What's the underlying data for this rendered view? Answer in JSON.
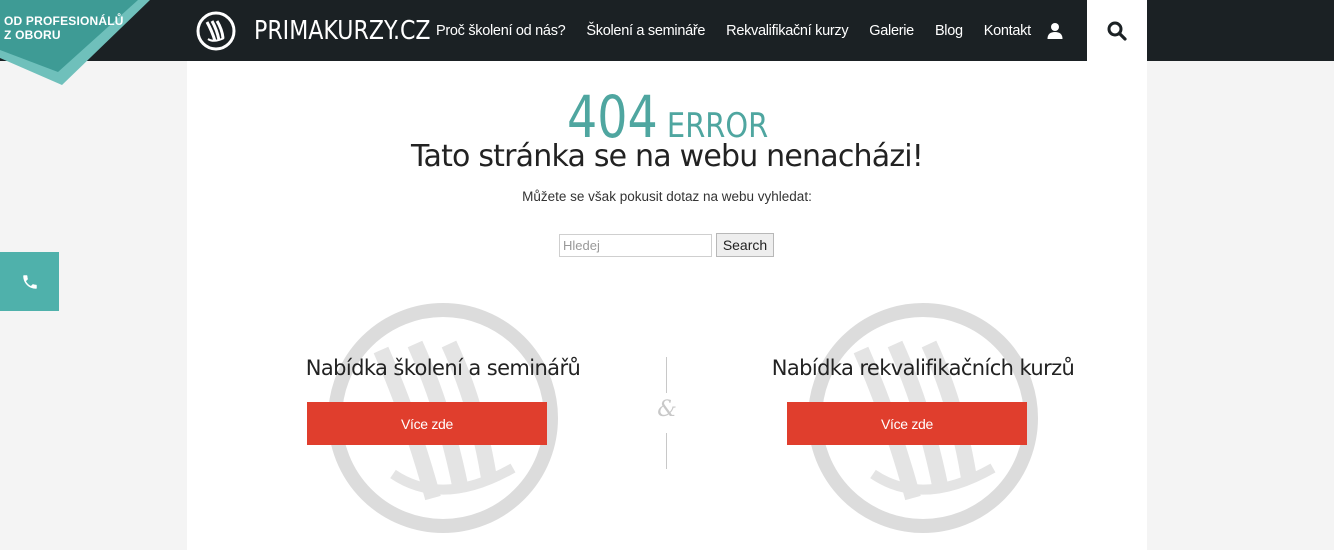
{
  "corner_badge": {
    "line1": "OD PROFESIONÁLŮ",
    "line2": "Z OBORU"
  },
  "brand": {
    "name": "PRIMAKURZY.CZ"
  },
  "menu": [
    {
      "label": "Proč školení od nás?"
    },
    {
      "label": "Školení a semináře"
    },
    {
      "label": "Rekvalifikační kurzy"
    },
    {
      "label": "Galerie"
    },
    {
      "label": "Blog"
    },
    {
      "label": "Kontakt"
    }
  ],
  "icons": {
    "logo": "logo-icon",
    "user": "user-icon",
    "search": "search-icon",
    "phone": "phone-icon"
  },
  "error": {
    "code": "404",
    "word": "ERROR",
    "heading": "Tato stránka se na webu nenacházi!",
    "subtext": "Můžete se však pokusit dotaz na webu vyhledat:"
  },
  "search": {
    "placeholder": "Hledej",
    "value": "",
    "button_label": "Search"
  },
  "offers": [
    {
      "title": "Nabídka školení a seminářů",
      "button": "Více zde"
    },
    {
      "title": "Nabídka rekvalifikačních kurzů",
      "button": "Více zde"
    }
  ],
  "separator": "&",
  "colors": {
    "navbar_bg": "#1b2124",
    "accent_teal": "#4fa6a0",
    "cta_red": "#e03e2d"
  }
}
